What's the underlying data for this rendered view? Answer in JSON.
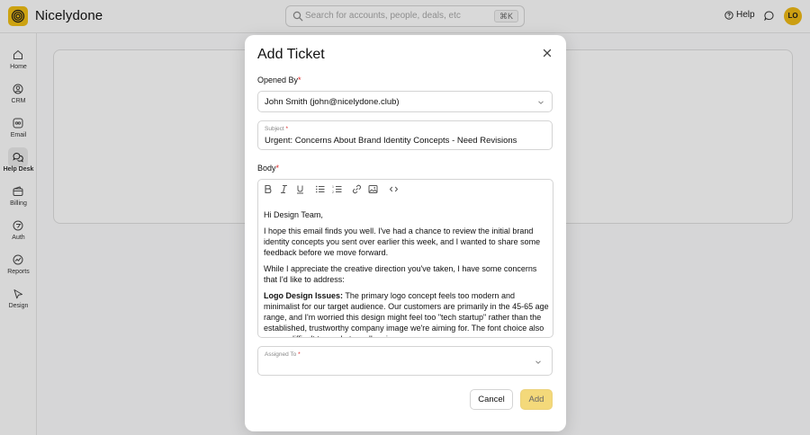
{
  "app": {
    "brand": "Nicelydone",
    "search_placeholder": "Search for accounts, people, deals, etc",
    "search_shortcut": "⌘K",
    "help_label": "Help",
    "avatar_initials": "LO",
    "brand_color": "#E8B415"
  },
  "sidebar": {
    "items": [
      {
        "label": "Home",
        "icon": "home-icon"
      },
      {
        "label": "CRM",
        "icon": "user-circle-icon"
      },
      {
        "label": "Email",
        "icon": "email-icon"
      },
      {
        "label": "Help Desk",
        "icon": "chat-bubbles-icon",
        "active": true
      },
      {
        "label": "Billing",
        "icon": "wallet-icon"
      },
      {
        "label": "Auth",
        "icon": "auth-icon"
      },
      {
        "label": "Reports",
        "icon": "reports-icon"
      },
      {
        "label": "Design",
        "icon": "cursor-icon"
      }
    ]
  },
  "modal": {
    "title": "Add Ticket",
    "opened_by_label": "Opened By",
    "opened_by_value": "John Smith (john@nicelydone.club)",
    "subject_label": "Subject",
    "subject_value": "Urgent: Concerns About Brand Identity Concepts - Need Revisions",
    "body_label": "Body",
    "body": {
      "greeting": "Hi Design Team,",
      "p1": "I hope this email finds you well. I've had a chance to review the initial brand identity concepts you sent over earlier this week, and I wanted to share some feedback before we move forward.",
      "p2": "While I appreciate the creative direction you've taken, I have some concerns that I'd like to address:",
      "p3_bold": "Logo Design Issues:",
      "p3_rest": " The primary logo concept feels too modern and minimalist for our target audience. Our customers are primarily in the 45-65 age range, and I'm worried this design might feel too \"tech startup\" rather than the established, trustworthy company image we're aiming for. The font choice also seems difficult to read at smaller sizes."
    },
    "assigned_label": "Assigned To",
    "required_mark": "*",
    "cancel_label": "Cancel",
    "add_label": "Add"
  }
}
